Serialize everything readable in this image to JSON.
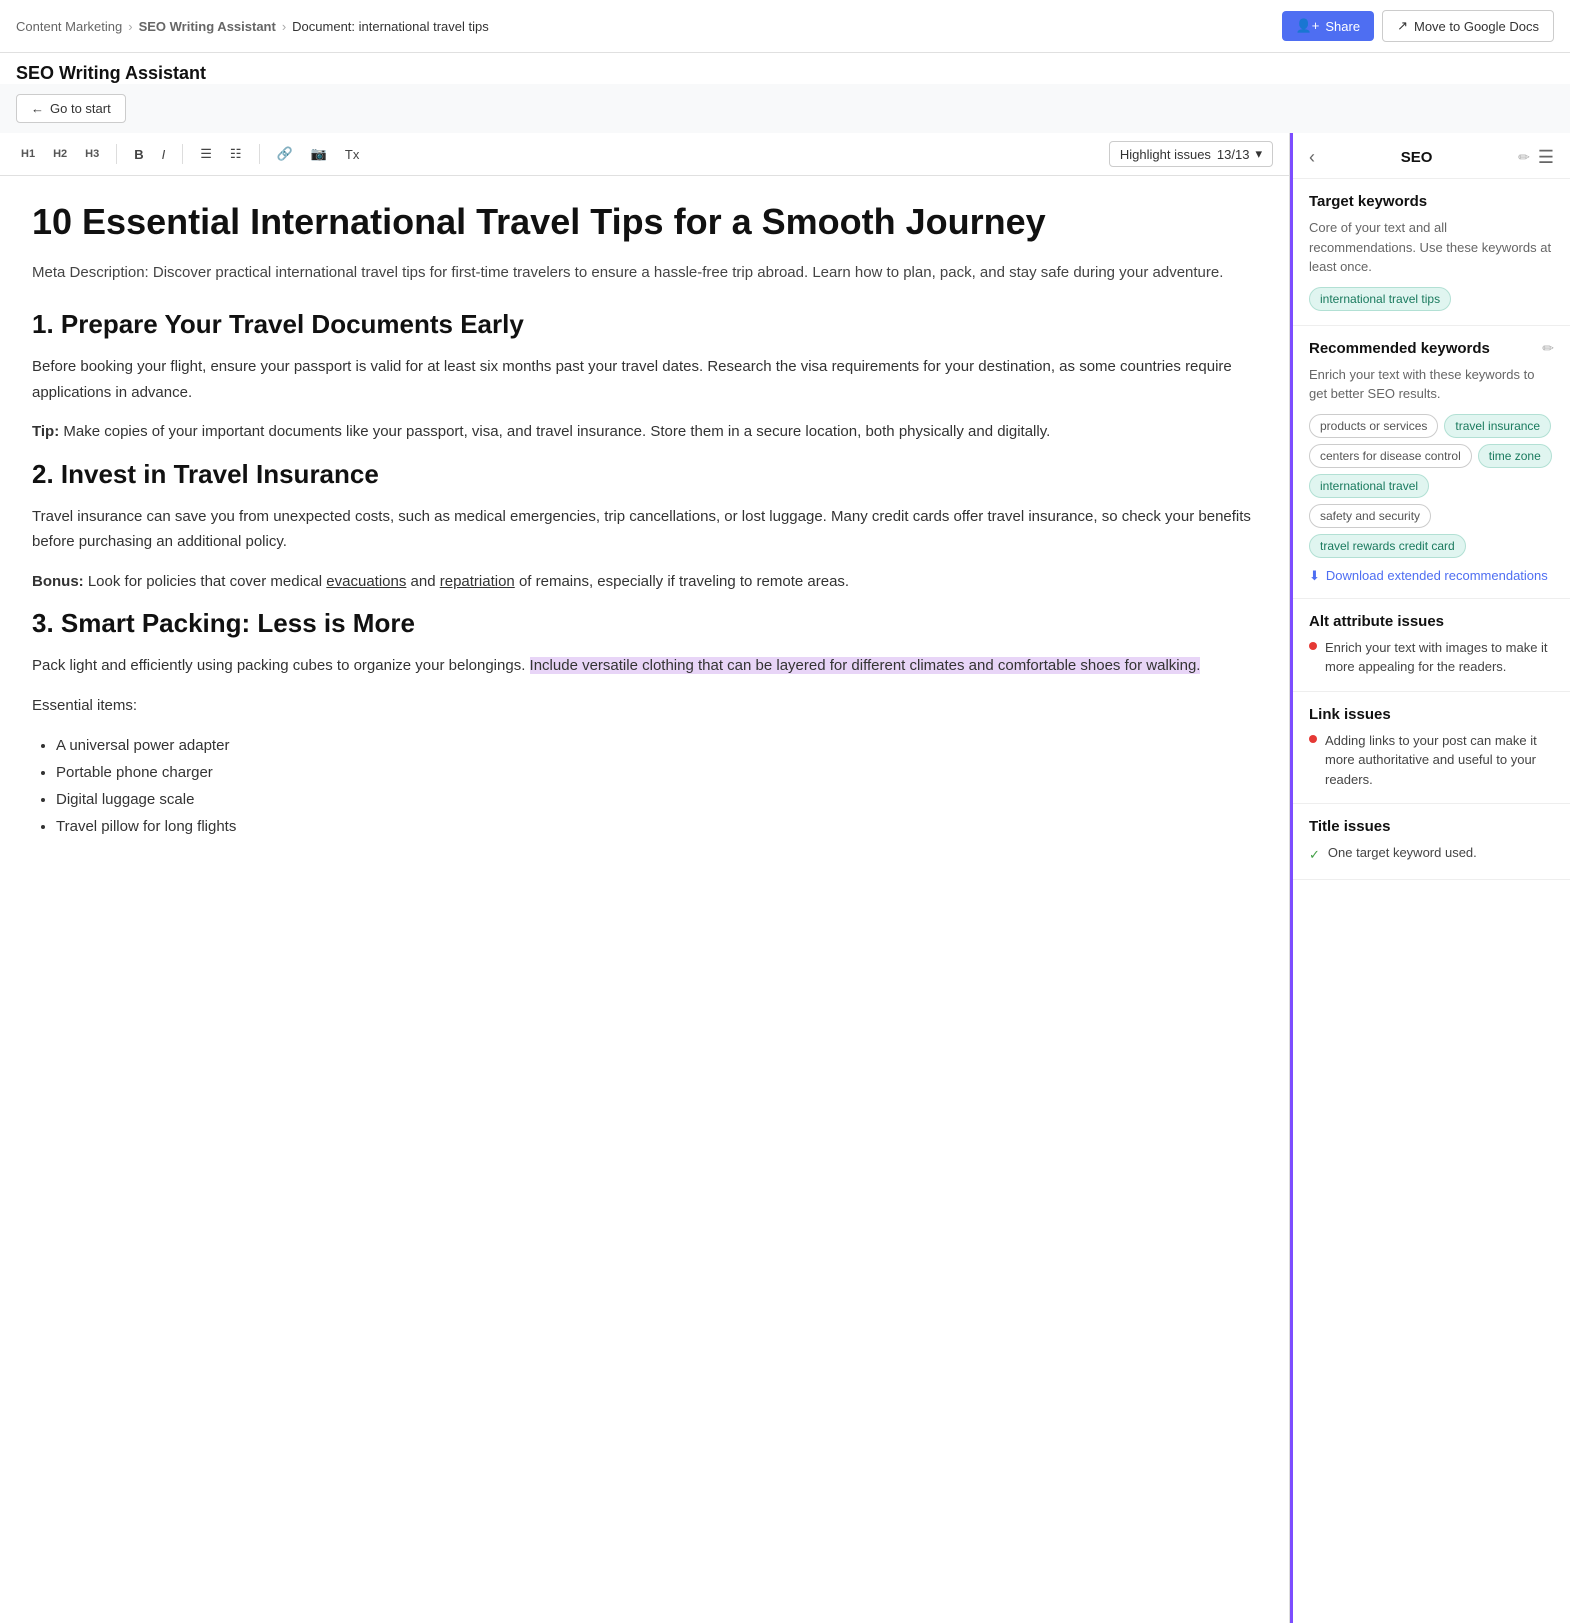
{
  "breadcrumb": {
    "items": [
      "Content Marketing",
      "SEO Writing Assistant",
      "Document: international travel tips"
    ]
  },
  "header": {
    "title": "SEO Writing Assistant",
    "share_label": "Share",
    "gdocs_label": "Move to Google Docs"
  },
  "go_to_start": "Go to start",
  "toolbar": {
    "h1": "H1",
    "h2": "H2",
    "h3": "H3",
    "bold": "B",
    "italic": "I",
    "highlight_label": "Highlight issues",
    "highlight_count": "13/13"
  },
  "editor": {
    "title": "10 Essential International Travel Tips for a Smooth Journey",
    "meta_desc": "Meta Description: Discover practical international travel tips for first-time travelers to ensure a hassle-free trip abroad. Learn how to plan, pack, and stay safe during your adventure.",
    "section1_title": "1. Prepare Your Travel Documents Early",
    "section1_p1": "Before booking your flight, ensure your passport is valid for at least six months past your travel dates. Research the visa requirements for your destination, as some countries require applications in advance.",
    "section1_tip": "Tip:",
    "section1_tip_text": " Make copies of your important documents like your passport, visa, and travel insurance. Store them in a secure location, both physically and digitally.",
    "section2_title": "2. Invest in Travel Insurance",
    "section2_p1": "Travel insurance can save you from unexpected costs, such as medical emergencies, trip cancellations, or lost luggage. Many credit cards offer travel insurance, so check your benefits before purchasing an additional policy.",
    "section2_bonus": "Bonus:",
    "section2_bonus_text": " Look for policies that cover medical evacuations and repatriation of remains, especially if traveling to remote areas.",
    "section3_title": "3. Smart Packing: Less is More",
    "section3_p1_before": "Pack light and efficiently using packing cubes to organize your belongings. ",
    "section3_p1_highlighted": "Include versatile clothing that can be layered for different climates and comfortable shoes for walking.",
    "section3_essential": "Essential items:",
    "section3_list": [
      "A universal power adapter",
      "Portable phone charger",
      "Digital luggage scale",
      "Travel pillow for long flights"
    ]
  },
  "panel": {
    "seo_label": "SEO",
    "target_keywords_title": "Target keywords",
    "target_keywords_desc": "Core of your text and all recommendations. Use these keywords at least once.",
    "target_keyword_tag": "international travel tips",
    "recommended_keywords_title": "Recommended keywords",
    "recommended_keywords_desc": "Enrich your text with these keywords to get better SEO results.",
    "recommended_keywords": [
      {
        "label": "products or services",
        "style": "outline"
      },
      {
        "label": "travel insurance",
        "style": "green"
      },
      {
        "label": "centers for disease control",
        "style": "outline"
      },
      {
        "label": "time zone",
        "style": "green"
      },
      {
        "label": "international travel",
        "style": "green"
      },
      {
        "label": "safety and security",
        "style": "outline"
      },
      {
        "label": "travel rewards credit card",
        "style": "green"
      }
    ],
    "download_label": "Download extended recommendations",
    "alt_attribute_title": "Alt attribute issues",
    "alt_attribute_desc": "Enrich your text with images to make it more appealing for the readers.",
    "link_issues_title": "Link issues",
    "link_issues_desc": "Adding links to your post can make it more authoritative and useful to your readers.",
    "title_issues_title": "Title issues",
    "title_issues_desc": "One target keyword used."
  }
}
